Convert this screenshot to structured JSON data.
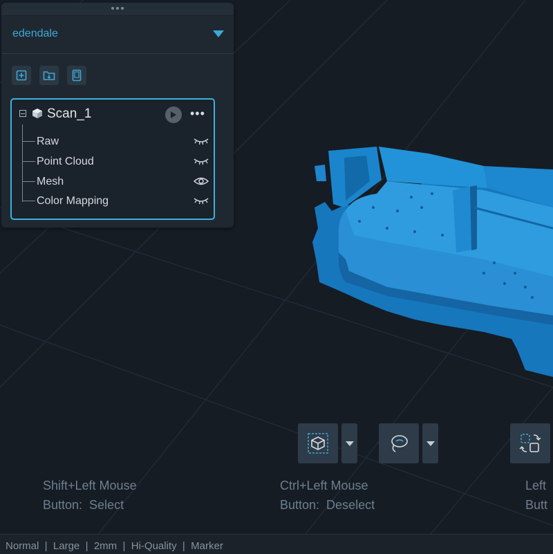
{
  "project": {
    "name": "edendale"
  },
  "scan": {
    "name": "Scan_1",
    "layers": [
      {
        "label": "Raw",
        "visibility": "hidden",
        "icon": "eye-closed-icon"
      },
      {
        "label": "Point Cloud",
        "visibility": "hidden",
        "icon": "eye-closed-icon"
      },
      {
        "label": "Mesh",
        "visibility": "visible",
        "icon": "eye-open-icon"
      },
      {
        "label": "Color Mapping",
        "visibility": "hidden",
        "icon": "eye-closed-icon"
      }
    ]
  },
  "toolbar": {
    "icons": [
      "add-project-icon",
      "open-folder-icon",
      "device-icon"
    ]
  },
  "hints": {
    "select": "Shift+Left Mouse\nButton:  Select",
    "deselect": "Ctrl+Left Mouse\nButton:  Deselect",
    "third": "Left\nButt"
  },
  "status": {
    "text": "Normal  |  Large  |  2mm  |  Hi-Quality  |  Marker"
  },
  "colors": {
    "accent": "#3fa8d8",
    "mesh": "#1a7fc4",
    "background": "#161c24",
    "panel": "#1f2831"
  }
}
